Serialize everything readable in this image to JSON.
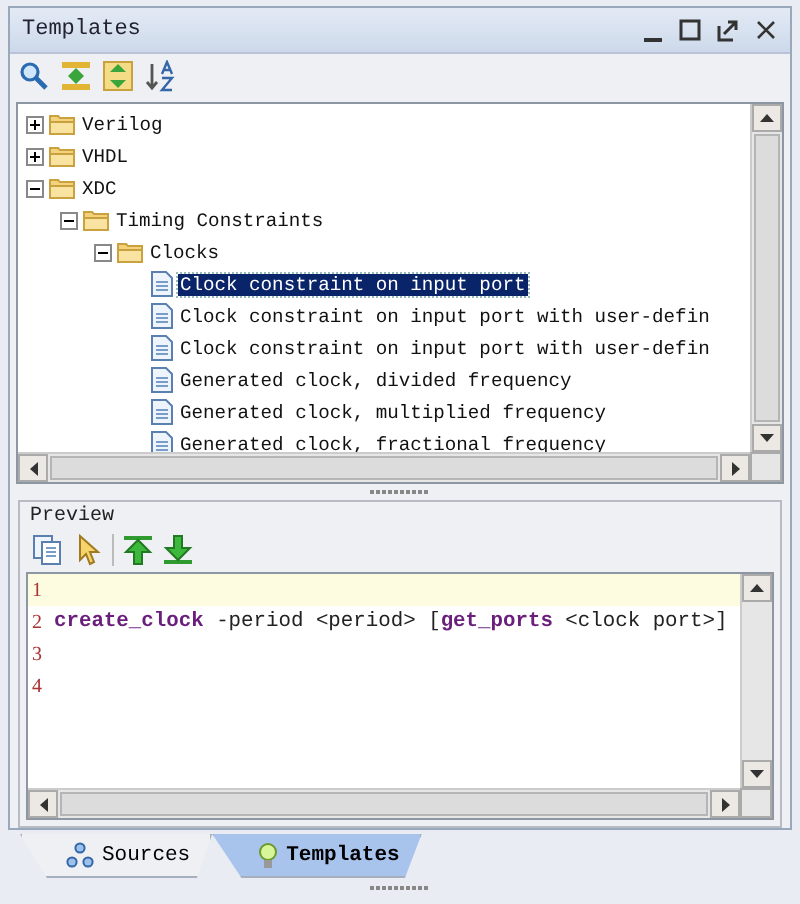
{
  "window": {
    "title": "Templates"
  },
  "tree": [
    {
      "label": "Verilog",
      "kind": "folder",
      "expanded": false,
      "selected": false
    },
    {
      "label": "VHDL",
      "kind": "folder",
      "expanded": false,
      "selected": false
    },
    {
      "label": "XDC",
      "kind": "folder",
      "expanded": true,
      "selected": false,
      "children": [
        {
          "label": "Timing Constraints",
          "kind": "folder",
          "expanded": true,
          "selected": false,
          "children": [
            {
              "label": "Clocks",
              "kind": "folder",
              "expanded": true,
              "selected": false,
              "children": [
                {
                  "label": "Clock constraint on input port",
                  "kind": "file",
                  "selected": true
                },
                {
                  "label": "Clock constraint on input port with user-defin",
                  "kind": "file",
                  "selected": false
                },
                {
                  "label": "Clock constraint on input port with user-defin",
                  "kind": "file",
                  "selected": false
                },
                {
                  "label": "Generated clock, divided frequency",
                  "kind": "file",
                  "selected": false
                },
                {
                  "label": "Generated clock, multiplied frequency",
                  "kind": "file",
                  "selected": false
                },
                {
                  "label": "Generated clock, fractional frequency",
                  "kind": "file",
                  "selected": false
                }
              ]
            }
          ]
        }
      ]
    }
  ],
  "preview": {
    "title": "Preview",
    "lines": [
      {
        "number": "1",
        "current": true
      },
      {
        "number": "2",
        "current": false,
        "segments": [
          {
            "kind": "keyword",
            "text": "create_clock"
          },
          {
            "kind": "plain",
            "text": " -period <period> ["
          },
          {
            "kind": "keyword",
            "text": "get_ports"
          },
          {
            "kind": "plain",
            "text": " <clock port>]"
          }
        ]
      },
      {
        "number": "3",
        "current": false
      },
      {
        "number": "4",
        "current": false
      }
    ]
  },
  "tabs": [
    {
      "label": "Sources",
      "selected": false
    },
    {
      "label": "Templates",
      "selected": true
    }
  ]
}
